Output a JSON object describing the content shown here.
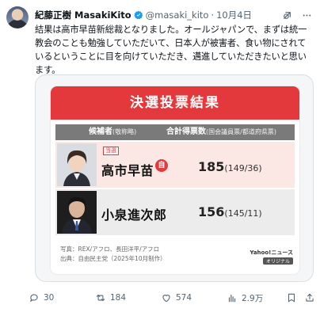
{
  "author": {
    "name": "紀藤正樹 MasakiKito",
    "handle": "@masaki_kito",
    "separator": "·",
    "date": "10月4日"
  },
  "tweet": {
    "text": "結果は高市早苗新総裁となりました。オールジャパンで、まずは統一教会のことも勉強していただいて、日本人が被害者、食い物にされているということに目を向けていただき、邁進していただきたいと思います。"
  },
  "graphic": {
    "title": "決選投票結果",
    "header_candidate": "候補者",
    "header_candidate_note": "(敬称略)",
    "header_votes": "合計得票数",
    "header_votes_note": "(国会議員票/都道府県票)",
    "candidates": [
      {
        "badge": "当選",
        "name": "高市早苗",
        "party_mark": "自",
        "total": "185",
        "breakdown": "(149/36)"
      },
      {
        "name": "小泉進次郎",
        "total": "156",
        "breakdown": "(145/11)"
      }
    ],
    "credit_photo": "写真：REX/アフロ、長田洋平/アフロ",
    "credit_source": "出典：自由民主党（2025年10月制作）",
    "logo": "Yahoo!ニュース",
    "logo_sub": "オリジナル"
  },
  "actions": {
    "replies": "30",
    "reposts": "184",
    "likes": "574",
    "views": "2.9万"
  },
  "colors": {
    "accent_red": "#e4393c",
    "verified_blue": "#1d9bf0",
    "muted_text": "#536471"
  }
}
